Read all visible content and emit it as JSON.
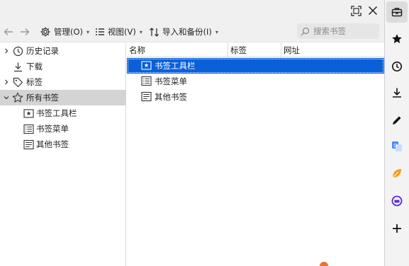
{
  "toolbar": {
    "manage_label": "管理(O)",
    "view_label": "视图(V)",
    "import_label": "导入和备份(I)",
    "search_placeholder": "搜索书签"
  },
  "sidebar": {
    "items": [
      {
        "label": "历史记录",
        "icon": "clock-icon",
        "expandable": true
      },
      {
        "label": "下载",
        "icon": "download-icon",
        "expandable": false
      },
      {
        "label": "标签",
        "icon": "tag-icon",
        "expandable": true
      },
      {
        "label": "所有书签",
        "icon": "star-icon",
        "expandable": true,
        "expanded": true,
        "selected": true
      },
      {
        "label": "书签工具栏",
        "icon": "bookmarks-toolbar-icon"
      },
      {
        "label": "书签菜单",
        "icon": "bookmarks-menu-icon"
      },
      {
        "label": "其他书签",
        "icon": "other-bookmarks-icon"
      }
    ]
  },
  "content": {
    "columns": [
      "名称",
      "标签",
      "网址"
    ],
    "rows": [
      {
        "name": "书签工具栏",
        "icon": "bookmarks-toolbar-icon",
        "selected": true
      },
      {
        "name": "书签菜单",
        "icon": "bookmarks-menu-icon"
      },
      {
        "name": "其他书签",
        "icon": "other-bookmarks-icon"
      }
    ]
  },
  "right_bar": {
    "icons": [
      "toolbox-icon",
      "star-icon",
      "history-icon",
      "download-icon",
      "pen-icon",
      "translate-icon",
      "leaf-icon",
      "shop-icon",
      "plus-icon"
    ],
    "active": "toolbox-icon"
  },
  "colors": {
    "selection": "#0a60d8",
    "chrome": "#f0f0f0",
    "sidebar_selected": "#d4d4d4"
  }
}
